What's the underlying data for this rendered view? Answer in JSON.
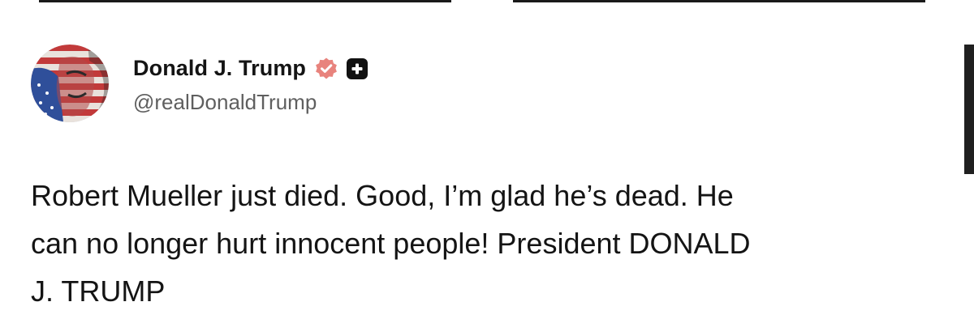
{
  "post": {
    "author": {
      "display_name": "Donald J. Trump",
      "handle": "@realDonaldTrump",
      "avatar": "flag-portrait-avatar",
      "badges": [
        "verified-badge-icon",
        "plus-badge-icon"
      ]
    },
    "text": "Robert Mueller just died. Good, I’m glad he’s dead. He\ncan no longer hurt innocent people! President DONALD\nJ. TRUMP"
  },
  "colors": {
    "verified_badge": "#e8837d",
    "plus_badge": "#111111",
    "handle_text": "#5f5f5f",
    "body_text": "#141414"
  }
}
